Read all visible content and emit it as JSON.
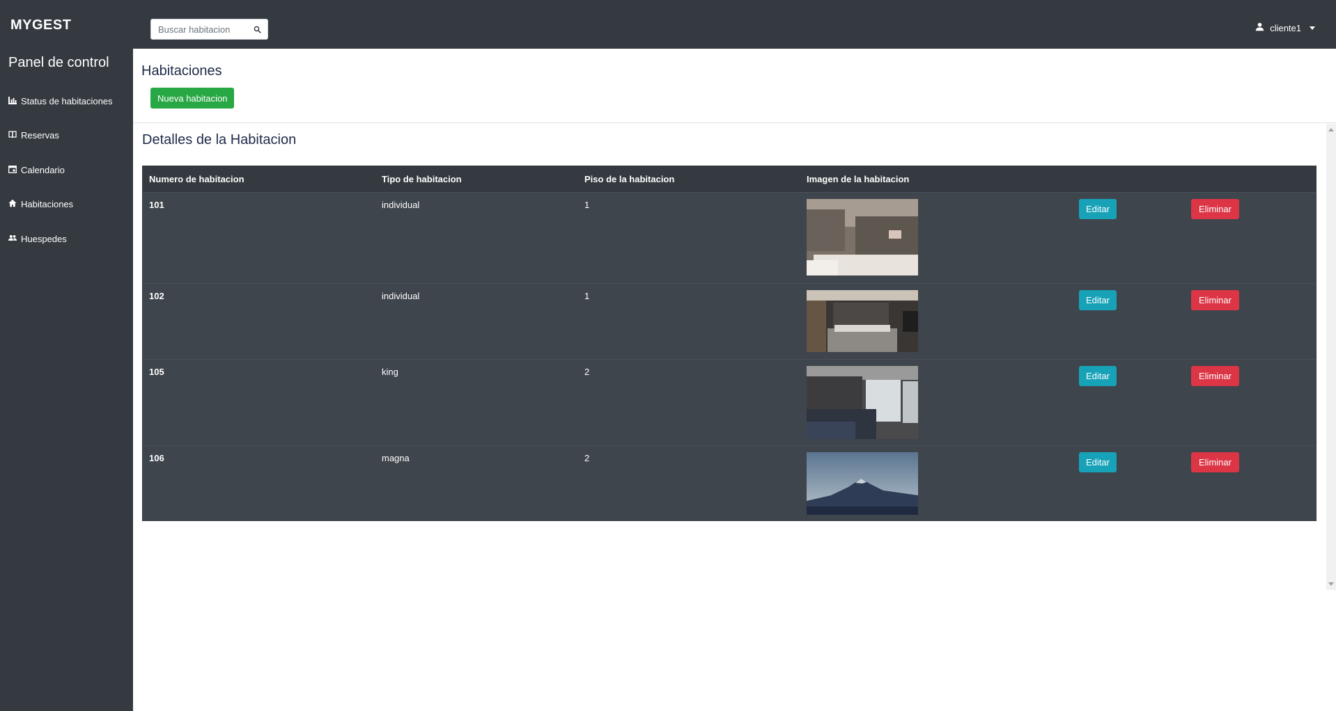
{
  "brand": "MYGEST",
  "search": {
    "placeholder": "Buscar habitacion"
  },
  "user": {
    "name": "cliente1"
  },
  "sidebar": {
    "title": "Panel de control",
    "items": [
      {
        "label": "Status de habitaciones",
        "icon": "bar-chart-icon"
      },
      {
        "label": "Reservas",
        "icon": "book-icon"
      },
      {
        "label": "Calendario",
        "icon": "calendar-icon"
      },
      {
        "label": "Habitaciones",
        "icon": "home-icon"
      },
      {
        "label": "Huespedes",
        "icon": "users-icon"
      }
    ]
  },
  "header": {
    "title": "Habitaciones",
    "new_button": "Nueva habitacion"
  },
  "details": {
    "title": "Detalles de la Habitacion",
    "columns": [
      "Numero de habitacion",
      "Tipo de habitacion",
      "Piso de la habitacion",
      "Imagen de la habitacion"
    ],
    "edit_label": "Editar",
    "delete_label": "Eliminar",
    "rows": [
      {
        "number": "101",
        "type": "individual",
        "floor": "1"
      },
      {
        "number": "102",
        "type": "individual",
        "floor": "1"
      },
      {
        "number": "105",
        "type": "king",
        "floor": "2"
      },
      {
        "number": "106",
        "type": "magna",
        "floor": "2"
      }
    ]
  }
}
